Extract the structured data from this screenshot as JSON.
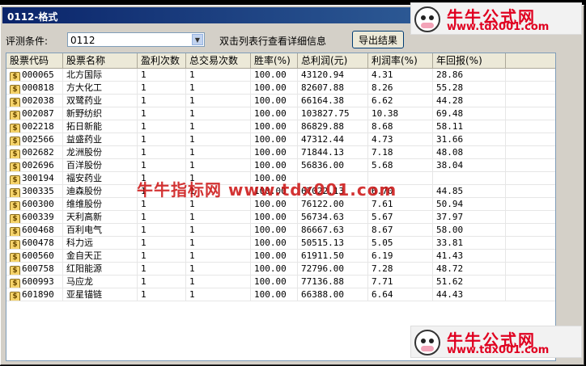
{
  "window": {
    "title": "0112-格式"
  },
  "toolbar": {
    "condition_label": "评测条件:",
    "condition_value": "0112",
    "hint": "双击列表行查看详细信息",
    "export_label": "导出结果"
  },
  "table": {
    "headers": [
      "股票代码",
      "股票名称",
      "盈利次数",
      "总交易次数",
      "胜率(%)",
      "总利润(元)",
      "利润率(%)",
      "年回报(%)",
      ""
    ],
    "rows": [
      [
        "000065",
        "北方国际",
        "1",
        "1",
        "100.00",
        "43120.94",
        "4.31",
        "28.86",
        ""
      ],
      [
        "000818",
        "方大化工",
        "1",
        "1",
        "100.00",
        "82607.88",
        "8.26",
        "55.28",
        ""
      ],
      [
        "002038",
        "双鹭药业",
        "1",
        "1",
        "100.00",
        "66164.38",
        "6.62",
        "44.28",
        ""
      ],
      [
        "002087",
        "新野纺织",
        "1",
        "1",
        "100.00",
        "103827.75",
        "10.38",
        "69.48",
        ""
      ],
      [
        "002218",
        "拓日新能",
        "1",
        "1",
        "100.00",
        "86829.88",
        "8.68",
        "58.11",
        ""
      ],
      [
        "002566",
        "益盛药业",
        "1",
        "1",
        "100.00",
        "47312.44",
        "4.73",
        "31.66",
        ""
      ],
      [
        "002682",
        "龙洲股份",
        "1",
        "1",
        "100.00",
        "71844.13",
        "7.18",
        "48.08",
        ""
      ],
      [
        "002696",
        "百洋股份",
        "1",
        "1",
        "100.00",
        "56836.00",
        "5.68",
        "38.04",
        ""
      ],
      [
        "300194",
        "福安药业",
        "1",
        "1",
        "100.00",
        "",
        "",
        "",
        ""
      ],
      [
        "300335",
        "迪森股份",
        "1",
        "1",
        "100.00",
        "67022.13",
        "6.70",
        "44.85",
        ""
      ],
      [
        "600300",
        "维维股份",
        "1",
        "1",
        "100.00",
        "76122.00",
        "7.61",
        "50.94",
        ""
      ],
      [
        "600339",
        "天利高新",
        "1",
        "1",
        "100.00",
        "56734.63",
        "5.67",
        "37.97",
        ""
      ],
      [
        "600468",
        "百利电气",
        "1",
        "1",
        "100.00",
        "86667.63",
        "8.67",
        "58.00",
        ""
      ],
      [
        "600478",
        "科力远",
        "1",
        "1",
        "100.00",
        "50515.13",
        "5.05",
        "33.81",
        ""
      ],
      [
        "600560",
        "金自天正",
        "1",
        "1",
        "100.00",
        "61911.50",
        "6.19",
        "41.43",
        ""
      ],
      [
        "600758",
        "红阳能源",
        "1",
        "1",
        "100.00",
        "72796.00",
        "7.28",
        "48.72",
        ""
      ],
      [
        "600993",
        "马应龙",
        "1",
        "1",
        "100.00",
        "77136.88",
        "7.71",
        "51.62",
        ""
      ],
      [
        "601890",
        "亚星锚链",
        "1",
        "1",
        "100.00",
        "66388.00",
        "6.64",
        "44.43",
        ""
      ]
    ]
  },
  "branding": {
    "logo_text": "牛牛公式网",
    "logo_url": "www.tdx001.com",
    "watermark": "牛牛指标网 www.tdx001.com"
  }
}
